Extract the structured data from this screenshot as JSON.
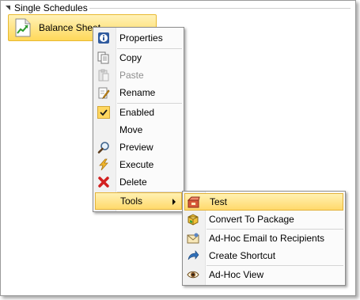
{
  "group": {
    "label": "Single Schedules"
  },
  "tile": {
    "label": "Balance Sheet",
    "icon": "chart-document-icon"
  },
  "context_menu": {
    "items": [
      {
        "label": "Properties",
        "icon": "info-icon",
        "enabled": true
      },
      {
        "label": "Copy",
        "icon": "copy-icon",
        "enabled": true
      },
      {
        "label": "Paste",
        "icon": "paste-icon",
        "enabled": false
      },
      {
        "label": "Rename",
        "icon": "rename-icon",
        "enabled": true
      },
      {
        "label": "Enabled",
        "icon": "checkmark-icon",
        "checked": true
      },
      {
        "label": "Move",
        "icon": "",
        "enabled": true
      },
      {
        "label": "Preview",
        "icon": "magnifier-icon",
        "enabled": true
      },
      {
        "label": "Execute",
        "icon": "lightning-icon",
        "enabled": true
      },
      {
        "label": "Delete",
        "icon": "red-x-icon",
        "enabled": true
      },
      {
        "label": "Tools",
        "icon": "",
        "enabled": true,
        "has_submenu": true
      }
    ]
  },
  "tools_submenu": {
    "items": [
      {
        "label": "Test",
        "icon": "test-box-icon"
      },
      {
        "label": "Convert To Package",
        "icon": "package-icon"
      },
      {
        "label": "Ad-Hoc Email to Recipients",
        "icon": "email-envelope-icon"
      },
      {
        "label": "Create Shortcut",
        "icon": "shortcut-arrow-icon"
      },
      {
        "label": "Ad-Hoc View",
        "icon": "eye-icon"
      }
    ]
  },
  "colors": {
    "highlight": "#ffd96b",
    "highlight_border": "#e3b23a",
    "disabled_text": "#8e8e8e"
  }
}
